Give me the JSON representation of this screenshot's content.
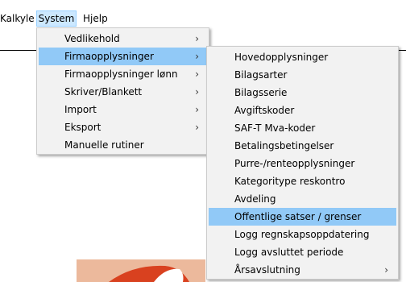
{
  "menubar": {
    "items": [
      {
        "label": "Kalkyle"
      },
      {
        "label": "System"
      },
      {
        "label": "Hjelp"
      }
    ]
  },
  "system_menu": {
    "items": [
      {
        "label": "Vedlikehold",
        "submenu": true
      },
      {
        "label": "Firmaopplysninger",
        "submenu": true,
        "selected": true
      },
      {
        "label": "Firmaopplysninger lønn",
        "submenu": true
      },
      {
        "label": "Skriver/Blankett",
        "submenu": true
      },
      {
        "label": "Import",
        "submenu": true
      },
      {
        "label": "Eksport",
        "submenu": true
      },
      {
        "label": "Manuelle rutiner",
        "submenu": false
      }
    ]
  },
  "firmaopplysninger_menu": {
    "items": [
      {
        "label": "Hovedopplysninger"
      },
      {
        "label": "Bilagsarter"
      },
      {
        "label": "Bilagsserie"
      },
      {
        "label": "Avgiftskoder"
      },
      {
        "label": "SAF-T Mva-koder"
      },
      {
        "label": "Betalingsbetingelser"
      },
      {
        "label": "Purre-/renteopplysninger"
      },
      {
        "label": "Kategoritype reskontro"
      },
      {
        "label": "Avdeling"
      },
      {
        "label": "Offentlige satser / grenser",
        "selected": true
      },
      {
        "label": "Logg regnskapsoppdatering"
      },
      {
        "label": "Logg avsluttet periode"
      },
      {
        "label": "Årsavslutning",
        "submenu": true
      }
    ]
  },
  "icons": {
    "submenu_arrow": "chevron-right-icon",
    "submenu_arrow_glyph": "›"
  },
  "colors": {
    "menu_bg": "#f2f2f2",
    "highlight": "#91c9f7",
    "menubar_active": "#cce8ff"
  }
}
